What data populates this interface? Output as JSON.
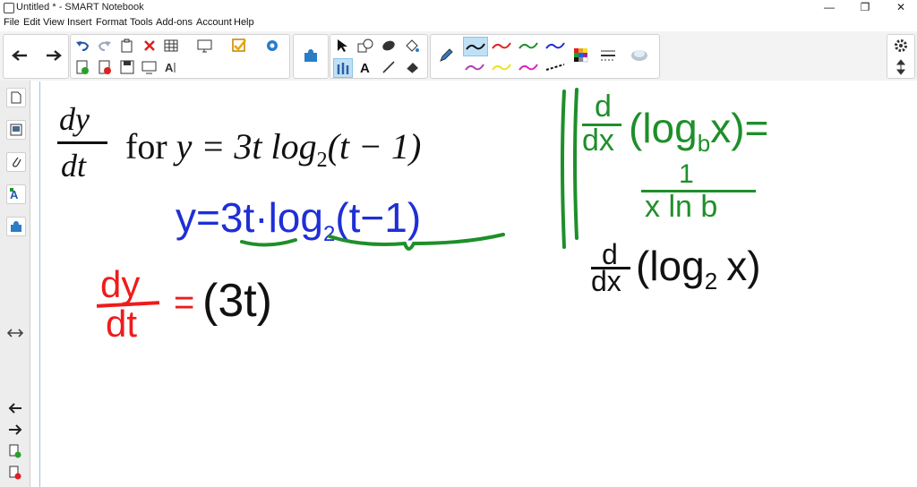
{
  "window": {
    "title": "Untitled * - SMART Notebook",
    "controls": [
      "—",
      "❐",
      "✕"
    ]
  },
  "menu": [
    "File",
    "Edit",
    "View",
    "Insert",
    "Format",
    "Tools",
    "Add-ons",
    "Account",
    "Help"
  ],
  "colors": {
    "blue_ink": "#1f2fd6",
    "green_ink": "#1e8f2a",
    "red_ink": "#ee1c1c",
    "black_ink": "#111111"
  },
  "problem": {
    "frac_num": "dy",
    "frac_den": "dt",
    "text_for": "for",
    "expression": "y = 3t log",
    "subscript": "2",
    "expression_tail": "(t − 1)"
  },
  "handwriting": {
    "line1_y": "y=",
    "line1_3t": "3t",
    "line1_dot": "·",
    "line1_log": "log",
    "line1_sub": "2",
    "line1_arg": "(t−1)",
    "dydt_num": "dy",
    "dydt_den": "dt",
    "equals": "=",
    "three_t": "(3t)",
    "rule_d_num": "d",
    "rule_d_den": "dx",
    "rule_log": "(log",
    "rule_sub_b": "b",
    "rule_arg": "x)=",
    "rule_result_num": "1",
    "rule_result_den": "x ln b",
    "deriv_d_num": "d",
    "deriv_d_den": "dx",
    "deriv_log": "(log",
    "deriv_sub": "2",
    "deriv_arg": "x)"
  }
}
